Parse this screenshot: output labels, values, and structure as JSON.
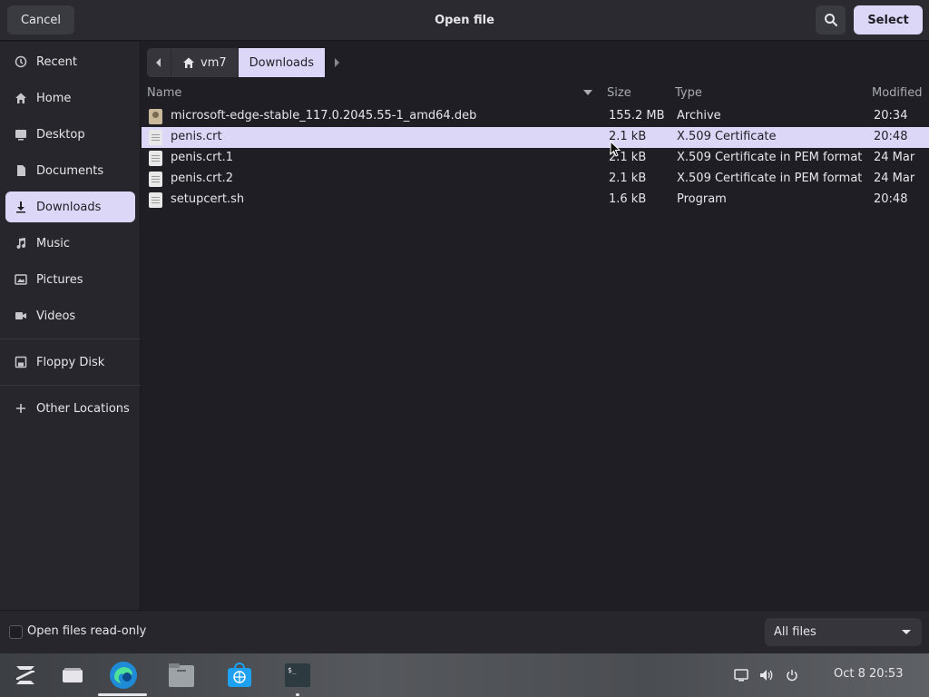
{
  "header": {
    "title": "Open file",
    "cancel_label": "Cancel",
    "select_label": "Select"
  },
  "sidebar": {
    "items": [
      {
        "label": "Recent",
        "icon": "clock-icon"
      },
      {
        "label": "Home",
        "icon": "home-icon"
      },
      {
        "label": "Desktop",
        "icon": "desktop-icon"
      },
      {
        "label": "Documents",
        "icon": "document-icon"
      },
      {
        "label": "Downloads",
        "icon": "download-icon"
      },
      {
        "label": "Music",
        "icon": "music-icon"
      },
      {
        "label": "Pictures",
        "icon": "picture-icon"
      },
      {
        "label": "Videos",
        "icon": "video-icon"
      },
      {
        "label": "Floppy Disk",
        "icon": "floppy-icon"
      },
      {
        "label": "Other Locations",
        "icon": "plus-icon"
      }
    ],
    "active": "Downloads"
  },
  "pathbar": {
    "crumbs": [
      "vm7",
      "Downloads"
    ]
  },
  "columns": {
    "name": "Name",
    "size": "Size",
    "type": "Type",
    "modified": "Modified"
  },
  "files": [
    {
      "name": "microsoft-edge-stable_117.0.2045.55-1_amd64.deb",
      "size": "155.2 MB",
      "type": "Archive",
      "modified": "20:34",
      "icon": "deb-package-icon"
    },
    {
      "name": "penis.crt",
      "size": "2.1 kB",
      "type": "X.509 Certificate",
      "modified": "20:48",
      "icon": "text-file-icon",
      "selected": true
    },
    {
      "name": "penis.crt.1",
      "size": "2.1 kB",
      "type": "X.509 Certificate in PEM format",
      "modified": "24 Mar",
      "icon": "text-file-icon"
    },
    {
      "name": "penis.crt.2",
      "size": "2.1 kB",
      "type": "X.509 Certificate in PEM format",
      "modified": "24 Mar",
      "icon": "text-file-icon"
    },
    {
      "name": "setupcert.sh",
      "size": "1.6 kB",
      "type": "Program",
      "modified": "20:48",
      "icon": "script-file-icon"
    }
  ],
  "footer": {
    "readonly_label": "Open files read-only",
    "readonly_checked": false,
    "filter_value": "All files"
  },
  "taskbar": {
    "clock": "Oct 8  20:53"
  },
  "colors": {
    "accent": "#dcd6f7",
    "background": "#1e1e24",
    "sidebar": "#26262c"
  }
}
